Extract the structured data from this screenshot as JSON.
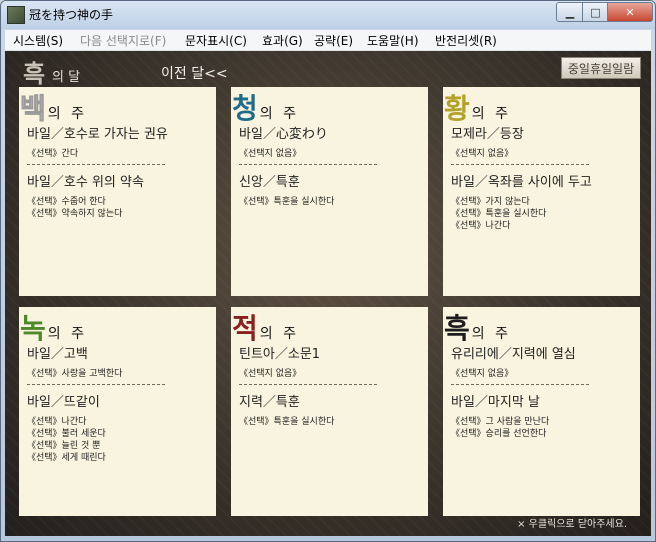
{
  "window": {
    "title": "冠を持つ神の手"
  },
  "menu": [
    {
      "label": "시스템(S)",
      "disabled": false
    },
    {
      "label": "다음 선택지로(F)",
      "disabled": true
    },
    {
      "label": "문자표시(C)",
      "disabled": false
    },
    {
      "label": "효과(G)",
      "disabled": false
    },
    {
      "label": "공략(E)",
      "disabled": false
    },
    {
      "label": "도움말(H)",
      "disabled": false
    },
    {
      "label": "반전리셋(R)",
      "disabled": false
    }
  ],
  "header": {
    "month_char": "흑",
    "month_rest": "의 달",
    "prev_month": "이전 달<<",
    "holiday_button": "중일휴일일람"
  },
  "colors": {
    "white": "#e8e8e8",
    "blue": "#1e6b8a",
    "yellow": "#b3a12a",
    "green": "#4e8a2a",
    "red": "#8a1f1f",
    "black": "#1c1c1c"
  },
  "panels": [
    {
      "char": "백",
      "suffix": "의 주",
      "sec1": {
        "title": "바일／호수로 가자는 권유",
        "choices": [
          "《선택》간다"
        ]
      },
      "sec2": {
        "title": "바일／호수 위의 약속",
        "choices": [
          "《선택》수줍어 한다",
          "《선택》약속하지 않는다"
        ]
      }
    },
    {
      "char": "청",
      "suffix": "의 주",
      "sec1": {
        "title": "바일／心変わり",
        "choices": [
          "《선택지 없음》"
        ]
      },
      "sec2": {
        "title": "신앙／특훈",
        "choices": [
          "《선택》특훈을 실시한다"
        ]
      }
    },
    {
      "char": "황",
      "suffix": "의 주",
      "sec1": {
        "title": "모제라／등장",
        "choices": [
          "《선택지 없음》"
        ]
      },
      "sec2": {
        "title": "바일／옥좌를 사이에 두고",
        "choices": [
          "《선택》가지 않는다",
          "《선택》특훈을 실시한다",
          "《선택》나간다"
        ]
      }
    },
    {
      "char": "녹",
      "suffix": "의 주",
      "sec1": {
        "title": "바일／고백",
        "choices": [
          "《선택》사랑을 고백한다"
        ]
      },
      "sec2": {
        "title": "바일／뜨같이",
        "choices": [
          "《선택》나간다",
          "《선택》불러 세운다",
          "《선택》늘린 것 뿐",
          "《선택》세게 때린다"
        ]
      }
    },
    {
      "char": "적",
      "suffix": "의 주",
      "sec1": {
        "title": "틴트아／소문1",
        "choices": [
          "《선택지 없음》"
        ]
      },
      "sec2": {
        "title": "지력／특훈",
        "choices": [
          "《선택》특훈을 실시한다"
        ]
      }
    },
    {
      "char": "흑",
      "suffix": "의 주",
      "sec1": {
        "title": "유리리에／지력에 열심",
        "choices": [
          "《선택지 없음》"
        ]
      },
      "sec2": {
        "title": "바일／마지막 날",
        "choices": [
          "《선택》그 사람을 만난다",
          "《선택》승리를 선언한다"
        ]
      }
    }
  ],
  "footer": "× 우클릭으로 닫아주세요."
}
